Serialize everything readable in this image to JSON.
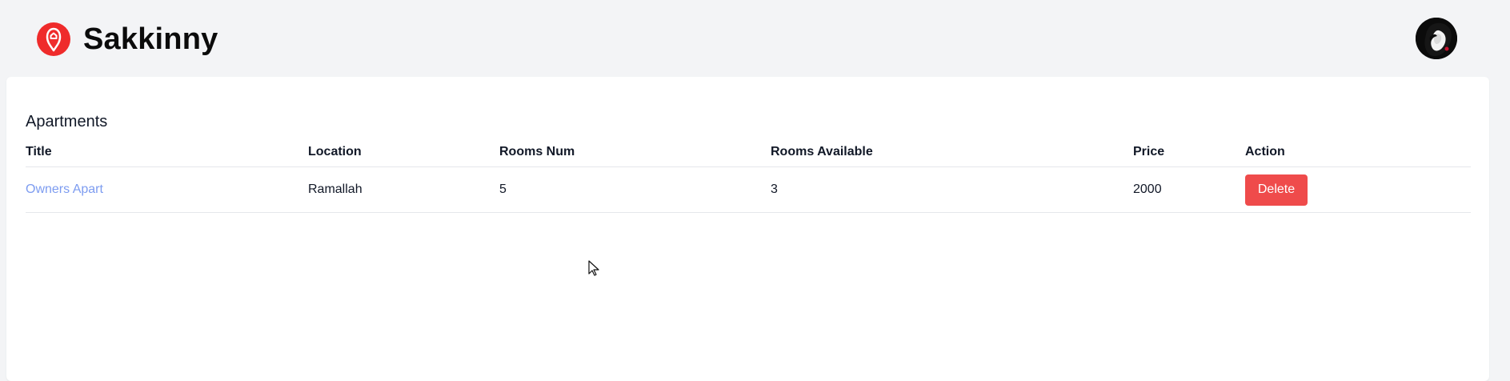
{
  "app": {
    "name": "Sakkinny",
    "logo_icon": "map-pin-icon",
    "avatar_icon": "user-avatar-icon",
    "brand_color": "#ef2b2b"
  },
  "apartments": {
    "heading": "Apartments",
    "columns": [
      "Title",
      "Location",
      "Rooms Num",
      "Rooms Available",
      "Price",
      "Action"
    ],
    "rows": [
      {
        "title": "Owners Apart",
        "location": "Ramallah",
        "rooms_num": "5",
        "rooms_available": "3",
        "price": "2000",
        "action_label": "Delete"
      }
    ]
  },
  "colors": {
    "background": "#f3f4f6",
    "card": "#ffffff",
    "link": "#7d9cf0",
    "delete": "#ef4b4b"
  }
}
